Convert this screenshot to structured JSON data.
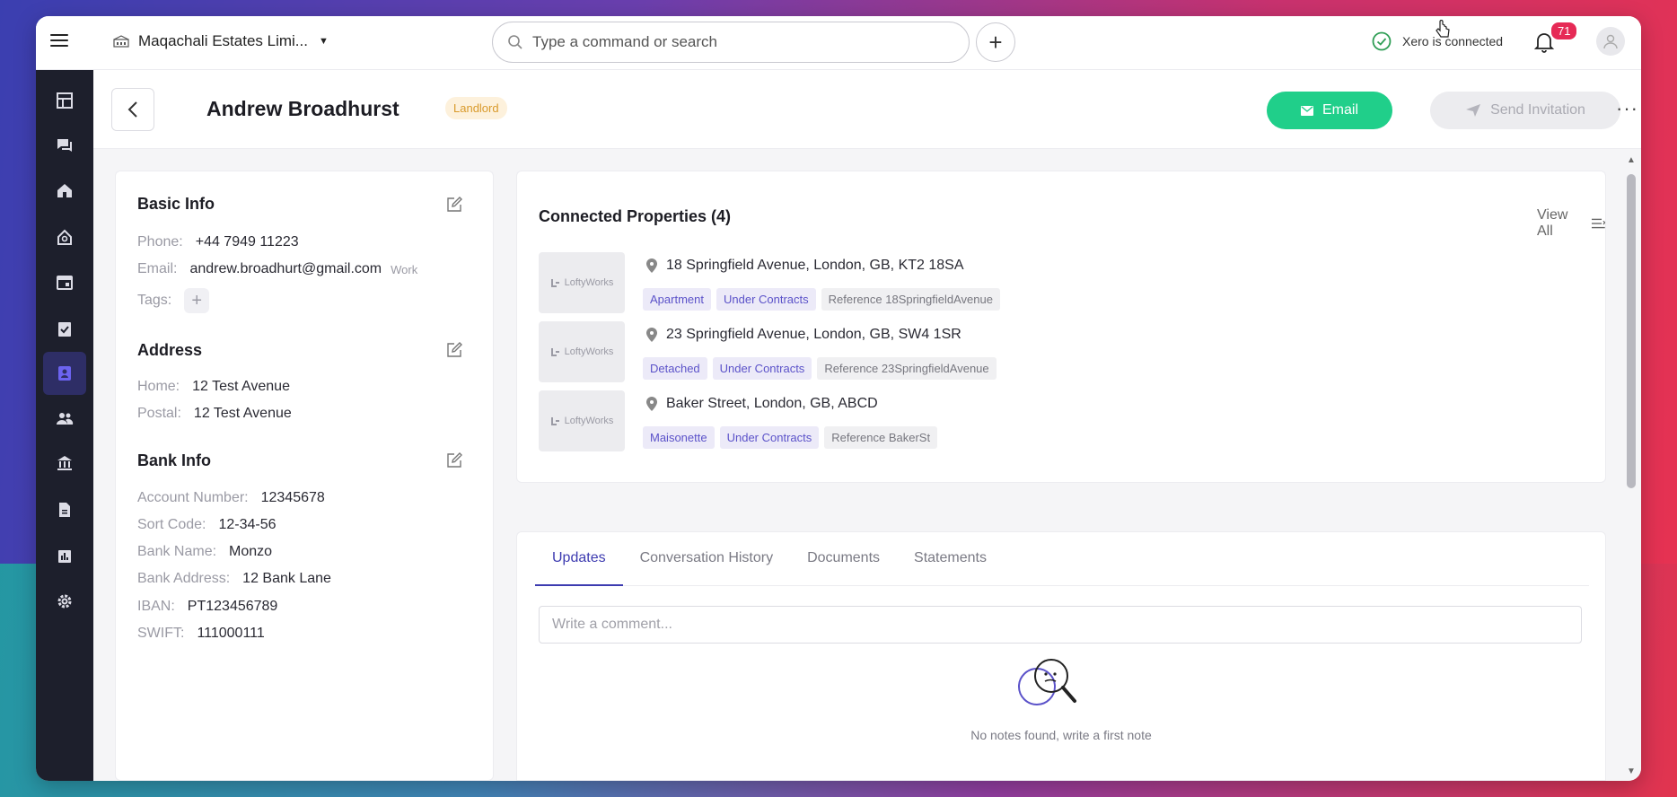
{
  "topbar": {
    "company_name": "Maqachali Estates Limi...",
    "search_placeholder": "Type a command or search",
    "xero_status": "Xero is connected",
    "notification_count": "71"
  },
  "header": {
    "name": "Andrew Broadhurst",
    "role": "Landlord",
    "email_label": "Email",
    "invite_label": "Send Invitation"
  },
  "basic_info": {
    "title": "Basic Info",
    "phone_label": "Phone:",
    "phone": "+44 7949 11223",
    "email_label": "Email:",
    "email": "andrew.broadhurt@gmail.com",
    "email_type": "Work",
    "tags_label": "Tags:"
  },
  "address": {
    "title": "Address",
    "home_label": "Home:",
    "home": "12 Test Avenue",
    "postal_label": "Postal:",
    "postal": "12 Test Avenue"
  },
  "bank_info": {
    "title": "Bank Info",
    "rows": [
      {
        "label": "Account Number:",
        "value": "12345678"
      },
      {
        "label": "Sort Code:",
        "value": "12-34-56"
      },
      {
        "label": "Bank Name:",
        "value": "Monzo"
      },
      {
        "label": "Bank Address:",
        "value": "12 Bank Lane"
      },
      {
        "label": "IBAN:",
        "value": "PT123456789"
      },
      {
        "label": "SWIFT:",
        "value": "111000111"
      }
    ]
  },
  "properties": {
    "title": "Connected Properties (4)",
    "view_all": "View All",
    "thumb_label": "LoftyWorks",
    "items": [
      {
        "address": "18 Springfield Avenue, London, GB, KT2 18SA",
        "type": "Apartment",
        "status": "Under Contracts",
        "reference": "Reference 18SpringfieldAvenue"
      },
      {
        "address": "23 Springfield Avenue, London, GB, SW4 1SR",
        "type": "Detached",
        "status": "Under Contracts",
        "reference": "Reference 23SpringfieldAvenue"
      },
      {
        "address": "Baker Street, London, GB, ABCD",
        "type": "Maisonette",
        "status": "Under Contracts",
        "reference": "Reference BakerSt"
      }
    ]
  },
  "tabs": {
    "items": [
      "Updates",
      "Conversation History",
      "Documents",
      "Statements"
    ],
    "active": "Updates",
    "comment_placeholder": "Write a comment...",
    "empty_text": "No notes found, write a first note"
  },
  "colors": {
    "accent": "#3d3bb0",
    "email_button": "#20cf8a",
    "badge": "#e62a56",
    "sidebar": "#1d1f2c"
  }
}
